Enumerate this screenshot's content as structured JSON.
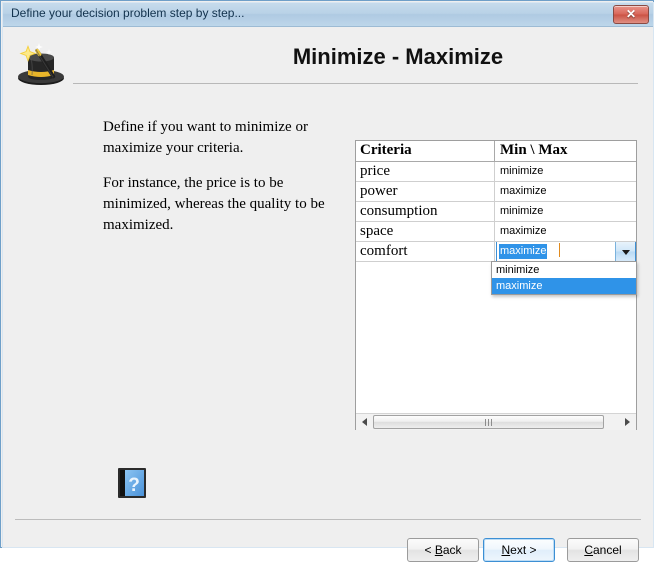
{
  "window": {
    "title": "Define your decision problem step by step...",
    "close_label": "✕",
    "close_icon": "close-icon"
  },
  "header": {
    "title": "Minimize - Maximize",
    "icon": "wizard-hat-icon"
  },
  "instructions": {
    "paragraph1": "Define if you want to minimize or maximize your criteria.",
    "paragraph2": "For instance, the price is to be minimized, whereas the quality to be maximized."
  },
  "table": {
    "columns": [
      "Criteria",
      "Min \\ Max"
    ],
    "rows": [
      {
        "criteria": "price",
        "minmax": "minimize"
      },
      {
        "criteria": "power",
        "minmax": "maximize"
      },
      {
        "criteria": "consumption",
        "minmax": "minimize"
      },
      {
        "criteria": "space",
        "minmax": "maximize"
      },
      {
        "criteria": "comfort",
        "minmax": "maximize"
      }
    ],
    "editing_row_index": 4,
    "combo": {
      "value": "maximize",
      "arrow_icon": "chevron-down-icon",
      "options": [
        "minimize",
        "maximize"
      ],
      "highlighted_option": "maximize"
    }
  },
  "scrollbar": {
    "left_arrow_icon": "chevron-left-icon",
    "right_arrow_icon": "chevron-right-icon",
    "thumb_grip_icon": "grip-icon"
  },
  "help": {
    "icon": "help-book-icon",
    "glyph": "?"
  },
  "footer": {
    "back": {
      "pre": "< ",
      "mnemonic": "B",
      "post": "ack"
    },
    "next": {
      "pre": "",
      "mnemonic": "N",
      "post": "ext >"
    },
    "cancel": {
      "pre": "",
      "mnemonic": "C",
      "post": "ancel"
    }
  },
  "colors": {
    "titlebar": "#b9d2e7",
    "dialog_bg": "#efefef",
    "accent_blue": "#2f93e8",
    "focus_border": "#3c8fd4",
    "close_red": "#d9675a"
  }
}
